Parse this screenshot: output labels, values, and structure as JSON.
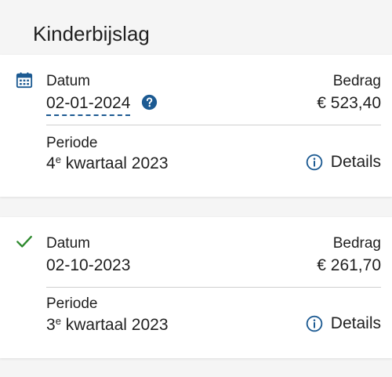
{
  "page": {
    "title": "Kinderbijslag"
  },
  "colors": {
    "accent": "#1c5a92",
    "success": "#2e8a2e",
    "divider": "#cfcfcf",
    "background": "#f5f5f5"
  },
  "payments": [
    {
      "status_icon": "calendar-icon",
      "datum_label": "Datum",
      "datum_value": "02-01-2024",
      "bedrag_label": "Bedrag",
      "bedrag_value": "€ 523,40",
      "periode_label": "Periode",
      "periode_number": "4",
      "periode_suffix": "e",
      "periode_rest": " kwartaal 2023",
      "details_label": "Details",
      "has_help": true
    },
    {
      "status_icon": "checkmark-icon",
      "datum_label": "Datum",
      "datum_value": "02-10-2023",
      "bedrag_label": "Bedrag",
      "bedrag_value": "€ 261,70",
      "periode_label": "Periode",
      "periode_number": "3",
      "periode_suffix": "e",
      "periode_rest": " kwartaal 2023",
      "details_label": "Details",
      "has_help": false
    }
  ]
}
